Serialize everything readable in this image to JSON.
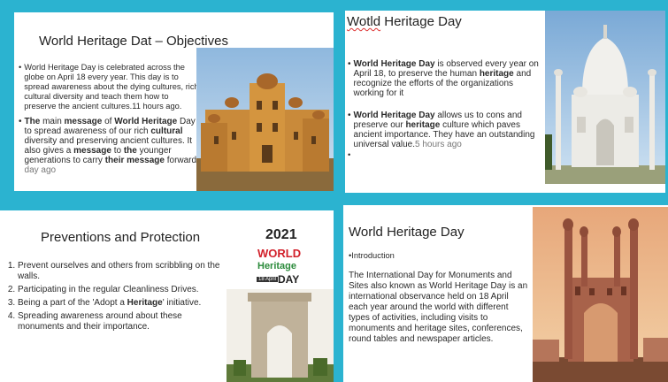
{
  "slide1": {
    "title": "World Heritage Dat – Objectives",
    "p1": "World Heritage Day is celebrated across the globe on April 18 every year. This day is to spread awareness about the dying cultures, rich cultural diversity and teach them how to preserve the ancient cultures.11 hours ago.",
    "p2_a": "The",
    "p2_b": " main ",
    "p2_c": "message",
    "p2_d": " of ",
    "p2_e": "World Heritage",
    "p2_f": " Day is to spread awareness of our rich ",
    "p2_g": "cultural",
    "p2_h": " diversity and preserving ancient cultures. It also gives a ",
    "p2_i": "message",
    "p2_j": " to ",
    "p2_k": "the",
    "p2_l": " younger generations to carry ",
    "p2_m": "their message",
    "p2_n": " forward.",
    "p2_time": "1 day ago"
  },
  "slide2": {
    "title_a": "Wotld",
    "title_b": " Heritage Day",
    "b1_a": "World Heritage Day",
    "b1_b": " is observed every year on April 18, to preserve the human ",
    "b1_c": "heritage",
    "b1_d": " and recognize the efforts of the organizations working for it",
    "b2_a": "World Heritage Day",
    "b2_b": " allows us to cons and preserve our ",
    "b2_c": "heritage",
    "b2_d": " culture which paves ancient importance. They have an outstanding universal value.",
    "b2_time": "5 hours ago"
  },
  "slide3": {
    "title": "Preventions and Protection",
    "items": [
      "Prevent ourselves and others from scribbling on the walls.",
      "Participating in the regular Cleanliness Drives.",
      "Being a part of the 'Adopt a ",
      "Spreading awareness around about these monuments and their importance."
    ],
    "item3_bold": "Heritage",
    "item3_tail": "' initiative.",
    "poster_year": "2021",
    "poster_line1": "WORLD",
    "poster_line2": "Heritage",
    "poster_date": "18 April",
    "poster_day": "DAY"
  },
  "slide4": {
    "title": "World Heritage Day",
    "intro": "Introduction",
    "body": "The International Day for Monuments and Sites also known as World Heritage Day is an international observance held on 18 April each year around the world with different types of activities, including visits to monuments and heritage sites, conferences, round tables and newspaper articles."
  }
}
